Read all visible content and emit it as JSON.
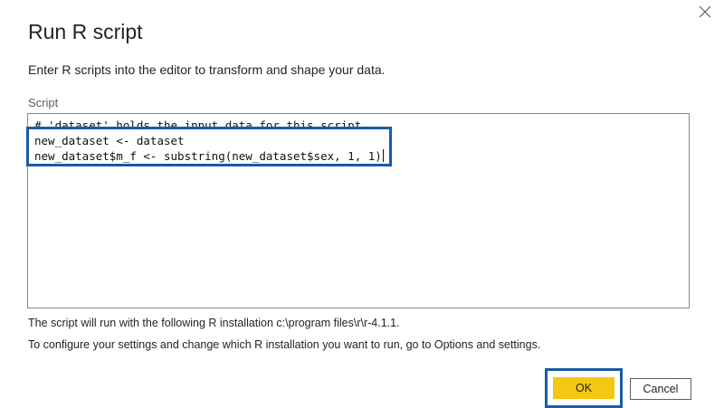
{
  "dialog": {
    "title": "Run R script",
    "subtitle": "Enter R scripts into the editor to transform and shape your data.",
    "close_icon": "close-icon"
  },
  "editor": {
    "label": "Script",
    "lines": [
      "# 'dataset' holds the input data for this script",
      "new_dataset <- dataset",
      "new_dataset$m_f <- substring(new_dataset$sex, 1, 1)"
    ]
  },
  "info": {
    "installation": "The script will run with the following R installation c:\\program files\\r\\r-4.1.1.",
    "configure": "To configure your settings and change which R installation you want to run, go to Options and settings."
  },
  "buttons": {
    "ok_label": "OK",
    "cancel_label": "Cancel"
  },
  "colors": {
    "accent_yellow": "#f2c811",
    "highlight_blue": "#1a5ba6"
  }
}
